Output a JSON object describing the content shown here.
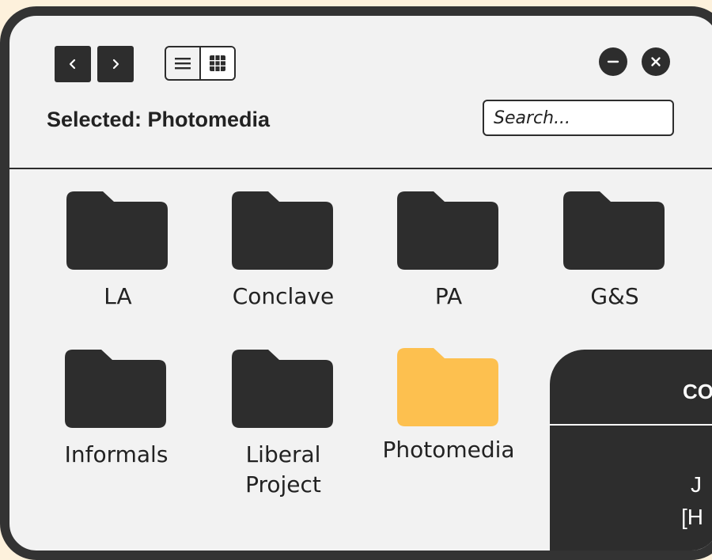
{
  "window": {
    "back_icon": "chevron-left-icon",
    "forward_icon": "chevron-right-icon",
    "view_toggle": {
      "options": [
        "list",
        "grid"
      ],
      "active": "grid"
    },
    "minimize_icon": "minus-icon",
    "close_icon": "close-icon"
  },
  "header": {
    "selected_label": "Selected: Photomedia"
  },
  "search": {
    "placeholder": "Search..."
  },
  "folders": [
    {
      "name": "LA",
      "selected": false
    },
    {
      "name": "Conclave",
      "selected": false
    },
    {
      "name": "PA",
      "selected": false
    },
    {
      "name": "G&S",
      "selected": false
    },
    {
      "name": "Informals",
      "selected": false
    },
    {
      "name": "Liberal Project",
      "name_line1": "Liberal",
      "name_line2": "Project",
      "selected": false
    },
    {
      "name": "Photomedia",
      "selected": true
    }
  ],
  "overlay": {
    "title": "CO",
    "line1": "J",
    "line2": "[H"
  },
  "colors": {
    "background": "#fdf1dc",
    "frame": "#333333",
    "window": "#f2f2f2",
    "folder": "#2d2d2d",
    "folder_selected": "#fdc04f"
  }
}
